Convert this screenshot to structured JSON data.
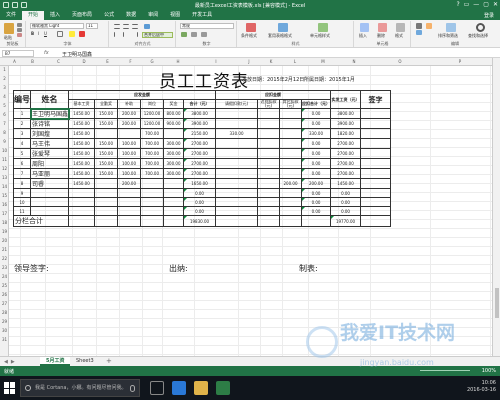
{
  "window": {
    "title": "最新员工excel工资表模板.xls [兼容模式] - Excel",
    "controls": [
      "?",
      "▭",
      "—",
      "▢",
      "✕"
    ]
  },
  "tabs": [
    "文件",
    "开始",
    "插入",
    "页面布局",
    "公式",
    "数据",
    "审阅",
    "视图",
    "开发工具"
  ],
  "tabs_active": 1,
  "login": "登录",
  "ribbon": {
    "paste": "粘贴",
    "clipboard": "剪贴板",
    "font_name": "微软雅黑 Light",
    "font_size": "11",
    "font_group": "字体",
    "align_group": "对齐方式",
    "merge": "合并后居中",
    "number_format": "常规",
    "number_group": "数字",
    "cond_format": "条件格式",
    "table_format": "套用表格格式",
    "cell_style": "单元格样式",
    "style_group": "样式",
    "insert": "插入",
    "delete": "删除",
    "format": "格式",
    "cells_group": "单元格",
    "sort": "排序和筛选",
    "find": "查找和选择",
    "edit_group": "编辑"
  },
  "formula_bar": {
    "name_box": "B7",
    "fx": "fx",
    "value": "王卫明马国鑫"
  },
  "columns": [
    "A",
    "B",
    "C",
    "D",
    "E",
    "F",
    "G",
    "H",
    "I",
    "J",
    "K",
    "L",
    "M",
    "N",
    "O",
    "P"
  ],
  "rows": [
    "1",
    "2",
    "3",
    "4",
    "5",
    "6",
    "7",
    "8",
    "9",
    "10",
    "11",
    "12",
    "13",
    "14",
    "15",
    "16",
    "17",
    "18",
    "19",
    "20",
    "21",
    "22",
    "23",
    "24",
    "25",
    "26",
    "27",
    "28",
    "29",
    "30",
    "31"
  ],
  "sheet": {
    "title": "员工工资表",
    "issue_date_label": "发放日期：",
    "issue_date": "2015年2月12日",
    "period_label": "所属日期：",
    "period": "2015年1月",
    "header": {
      "no": "编号",
      "name": "姓名",
      "payable": "应发金额",
      "deduct": "应扣金额",
      "net": "实发工资（元）",
      "sign": "签字"
    },
    "subheaders": [
      "基本工资",
      "全勤奖",
      "补助",
      "岗位",
      "奖金",
      "合计（元）",
      "请假扣款(元)",
      "迟到扣款(元)",
      "其它扣款(元)",
      "应扣合计（元）"
    ],
    "rows": [
      [
        "1",
        "王卫明马国鑫",
        "1450.00",
        "150.00",
        "200.00",
        "1200.00",
        "800.00",
        "3800.00",
        "",
        "",
        "",
        "0.00",
        "3800.00"
      ],
      [
        "2",
        "张诗铭",
        "1450.00",
        "150.00",
        "200.00",
        "1200.00",
        "900.00",
        "3900.00",
        "",
        "",
        "",
        "0.00",
        "3900.00"
      ],
      [
        "3",
        "刘国煌",
        "1450.00",
        "",
        "",
        "700.00",
        "",
        "2150.00",
        "330.00",
        "",
        "",
        "330.00",
        "1820.00"
      ],
      [
        "4",
        "马王伟",
        "1450.00",
        "150.00",
        "100.00",
        "700.00",
        "300.00",
        "2700.00",
        "",
        "",
        "",
        "0.00",
        "2700.00"
      ],
      [
        "5",
        "张爱琴",
        "1450.00",
        "150.00",
        "100.00",
        "700.00",
        "300.00",
        "2700.00",
        "",
        "",
        "",
        "0.00",
        "2700.00"
      ],
      [
        "6",
        "周阳",
        "1450.00",
        "150.00",
        "100.00",
        "700.00",
        "300.00",
        "2700.00",
        "",
        "",
        "",
        "0.00",
        "2700.00"
      ],
      [
        "7",
        "马亚丽",
        "1450.00",
        "150.00",
        "100.00",
        "700.00",
        "300.00",
        "2700.00",
        "",
        "",
        "",
        "0.00",
        "2700.00"
      ],
      [
        "8",
        "司睿",
        "1450.00",
        "",
        "200.00",
        "",
        "",
        "1650.00",
        "",
        "",
        "200.00",
        "200.00",
        "1450.00"
      ],
      [
        "9",
        "",
        "",
        "",
        "",
        "",
        "",
        "0.00",
        "",
        "",
        "",
        "0.00",
        "0.00"
      ],
      [
        "10",
        "",
        "",
        "",
        "",
        "",
        "",
        "0.00",
        "",
        "",
        "",
        "0.00",
        "0.00"
      ],
      [
        "11",
        "",
        "",
        "",
        "",
        "",
        "",
        "0.00",
        "",
        "",
        "",
        "0.00",
        "0.00"
      ]
    ],
    "subtotal_label": "分栏合计",
    "subtotal": "19830.00",
    "net_total": "19770.00",
    "leader_sign": "领导签字:",
    "cashier": "出纳:",
    "maker": "制表:"
  },
  "sheet_tabs": [
    "5月工资",
    "Sheet3"
  ],
  "sheet_tabs_active": 0,
  "add_sheet": "+",
  "status": {
    "ready": "就绪",
    "zoom": "100%"
  },
  "taskbar": {
    "search": "我是 Cortana，小娜。有问题尽管问我。",
    "time": "10:06",
    "date": "2016-03-16"
  },
  "watermark": {
    "cn": "我爱IT技术网",
    "en": "jingyan.baidu.com"
  },
  "colors": {
    "excel_green": "#217346",
    "selected_border": "#217346",
    "taskbar": "#10151c"
  }
}
